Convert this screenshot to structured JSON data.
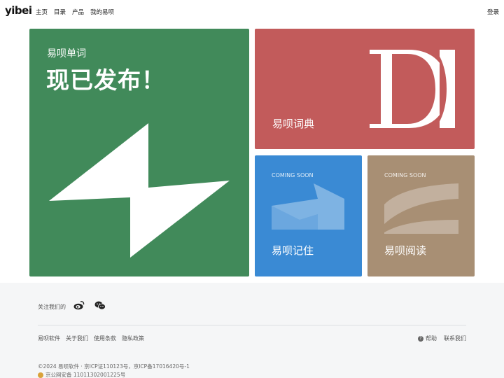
{
  "header": {
    "logo": "yibei",
    "nav": [
      "主页",
      "目录",
      "产品",
      "我的易呗"
    ],
    "login": "登录"
  },
  "tiles": {
    "green": {
      "subtitle": "易呗单词",
      "title": "现已发布！",
      "color": "#418a5a"
    },
    "red": {
      "label": "易呗词典",
      "color": "#c25b5b"
    },
    "blue": {
      "badge": "COMING SOON",
      "label": "易呗记住",
      "color": "#3a8ad4"
    },
    "tan": {
      "badge": "COMING SOON",
      "label": "易呗阅读",
      "color": "#a88f74"
    }
  },
  "footer": {
    "follow": "关注我们的",
    "links": [
      "易呗软件",
      "关于我们",
      "使用条款",
      "隐私政策"
    ],
    "help": "帮助",
    "contact": "联系我们",
    "copyright": "©2024 易呗软件 · 京ICP证110123号，京ICP备17016420号-1",
    "police": "京公网安备 11011302001225号"
  }
}
